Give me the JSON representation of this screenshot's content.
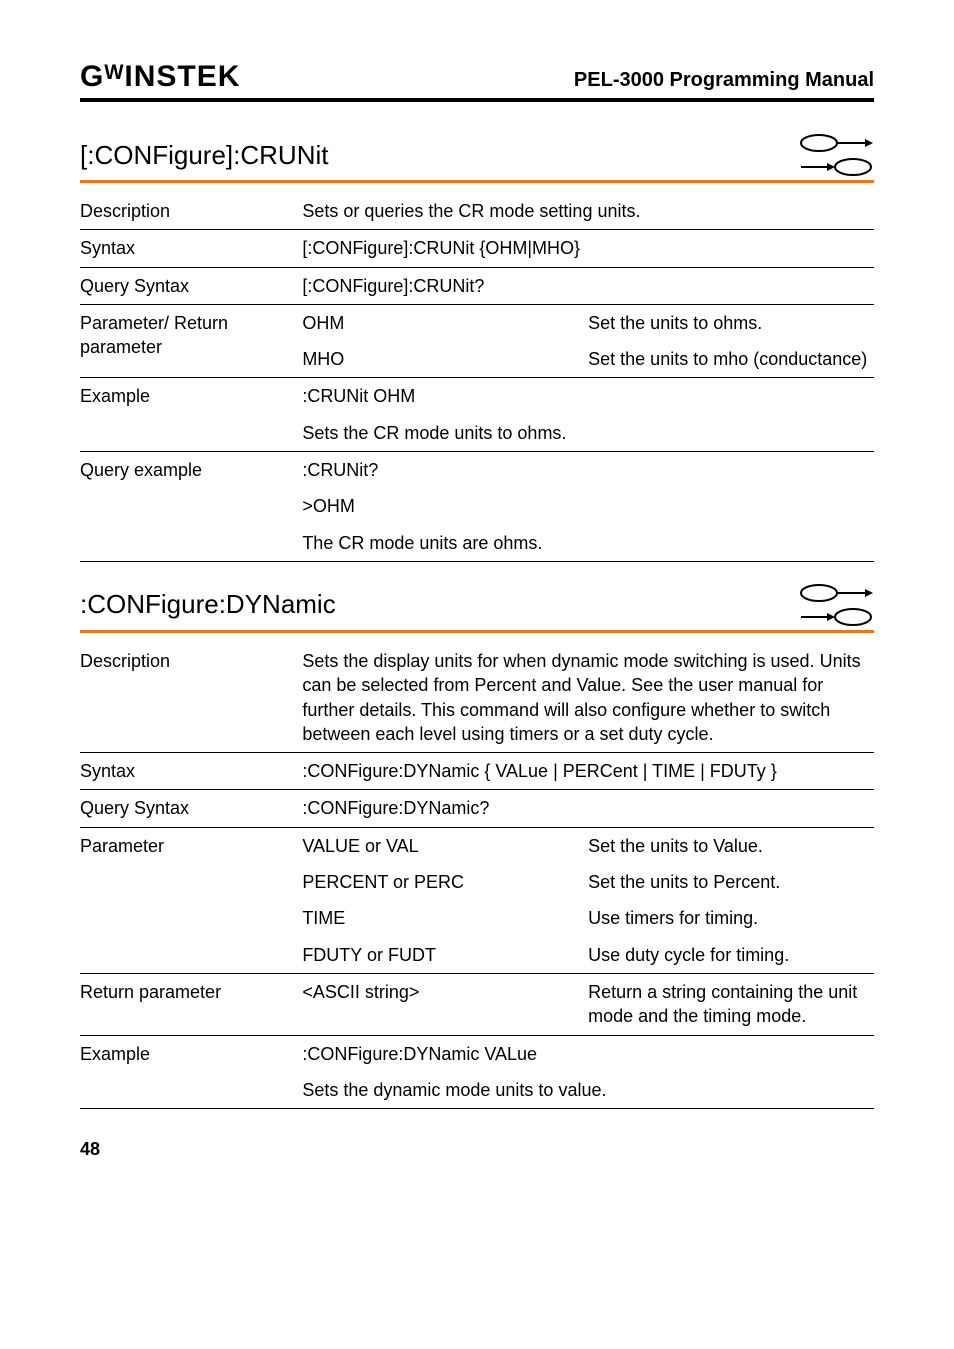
{
  "header": {
    "logo": "GᵂINSTEK",
    "manual_title": "PEL-3000 Programming Manual"
  },
  "cmd1": {
    "heading": "[:CONFigure]:CRUNit",
    "description_label": "Description",
    "description_text": "Sets or queries the CR mode setting units.",
    "syntax_label": "Syntax",
    "syntax_text": "[:CONFigure]:CRUNit {OHM|MHO}",
    "query_syntax_label": "Query Syntax",
    "query_syntax_text": "[:CONFigure]:CRUNit?",
    "param_label": "Parameter/ Return parameter",
    "param_rows": [
      {
        "name": "OHM",
        "desc": "Set the units to ohms."
      },
      {
        "name": "MHO",
        "desc": "Set the units to mho (conductance)"
      }
    ],
    "example_label": "Example",
    "example_cmd": ":CRUNit OHM",
    "example_desc": "Sets the CR mode units to ohms.",
    "query_example_label": "Query example",
    "query_example_cmd": ":CRUNit?",
    "query_example_resp": ">OHM",
    "query_example_desc": "The CR mode units are ohms."
  },
  "cmd2": {
    "heading": ":CONFigure:DYNamic",
    "description_label": "Description",
    "description_text": "Sets the display units for when dynamic mode switching is used. Units can be selected from Percent and Value. See the user manual for further details. This command will also configure whether to switch between each level using timers or a set duty cycle.",
    "syntax_label": "Syntax",
    "syntax_text": ":CONFigure:DYNamic { VALue | PERCent | TIME | FDUTy }",
    "query_syntax_label": "Query Syntax",
    "query_syntax_text": ":CONFigure:DYNamic?",
    "parameter_label": "Parameter",
    "parameter_rows": [
      {
        "name": "VALUE or VAL",
        "desc": "Set the units to Value."
      },
      {
        "name": "PERCENT or PERC",
        "desc": "Set the units to Percent."
      },
      {
        "name": "TIME",
        "desc": "Use timers for timing."
      },
      {
        "name": "FDUTY or FUDT",
        "desc": "Use duty cycle for timing."
      }
    ],
    "return_param_label": "Return parameter",
    "return_param_name": "<ASCII string>",
    "return_param_desc": "Return a string containing the unit mode and the timing mode.",
    "example_label": "Example",
    "example_cmd": ":CONFigure:DYNamic VALue",
    "example_desc": "Sets the dynamic mode units to value."
  },
  "page_number": "48"
}
